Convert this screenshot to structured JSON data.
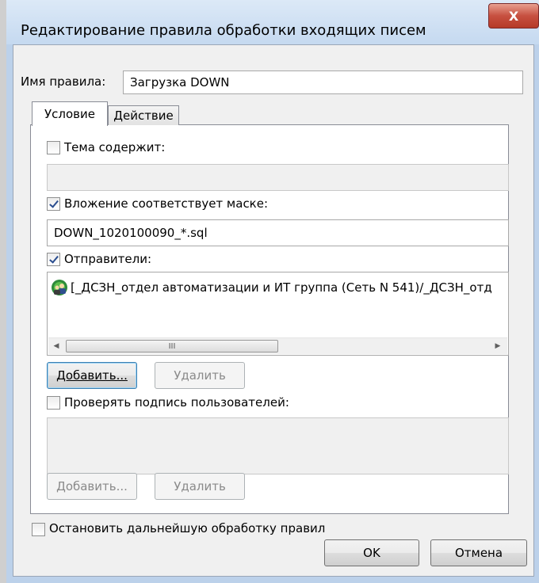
{
  "window": {
    "title": "Редактирование правила обработки входящих писем",
    "close_glyph": "X"
  },
  "rule_name": {
    "label": "Имя правила:",
    "value": "Загрузка DOWN"
  },
  "tabs": [
    {
      "label": "Условие",
      "active": true
    },
    {
      "label": "Действие",
      "active": false
    }
  ],
  "condition": {
    "subject": {
      "label": "Тема содержит:",
      "checked": false,
      "value": ""
    },
    "attachment": {
      "label": "Вложение соответствует маске:",
      "checked": true,
      "value": "DOWN_1020100090_*.sql"
    },
    "senders": {
      "label": "Отправители:",
      "checked": true,
      "items": [
        {
          "text": "[_ДСЗН_отдел автоматизации и ИТ группа (Сеть N 541)/_ДСЗН_отд",
          "icon": "group-users-icon"
        }
      ],
      "scrollbar_grip": "III",
      "add_label": "Добавить...",
      "remove_label": "Удалить"
    },
    "verify_signature": {
      "label": "Проверять подпись пользователей:",
      "checked": false,
      "add_label": "Добавить...",
      "remove_label": "Удалить"
    }
  },
  "stop_processing": {
    "label": "Остановить дальнейшую обработку правил",
    "checked": false
  },
  "buttons": {
    "ok": "OK",
    "cancel": "Отмена"
  }
}
